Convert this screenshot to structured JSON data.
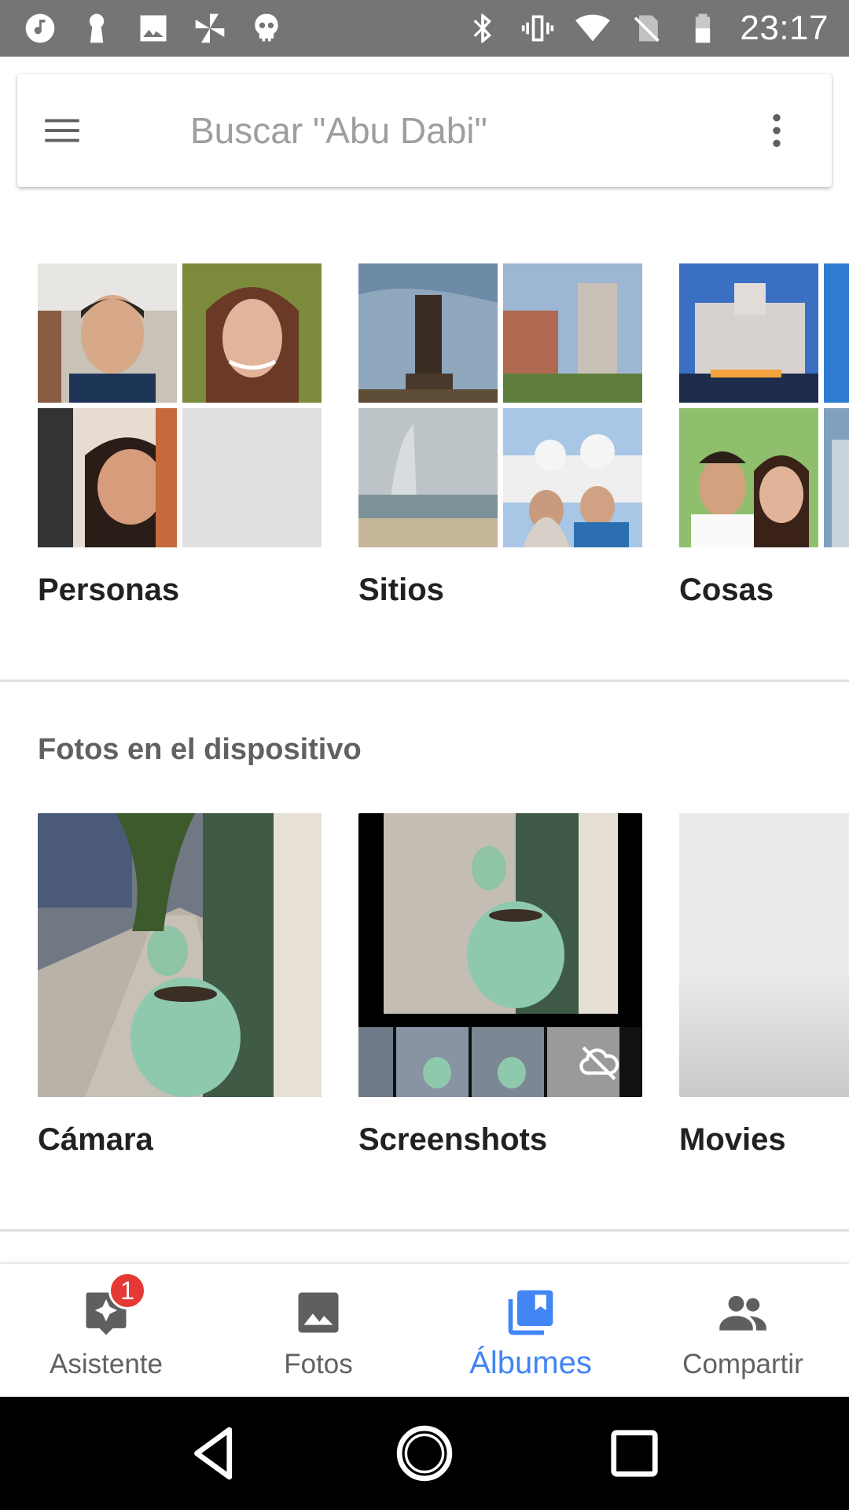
{
  "status_bar": {
    "time": "23:17",
    "left_icons": [
      "music-note-icon",
      "keyhole-icon",
      "image-icon",
      "pinwheel-icon",
      "skull-icon"
    ],
    "right_icons": [
      "bluetooth-icon",
      "vibrate-icon",
      "wifi-icon",
      "no-sim-icon",
      "battery-icon"
    ]
  },
  "search": {
    "placeholder": "Buscar \"Abu Dabi\""
  },
  "top_albums": [
    {
      "label": "Personas"
    },
    {
      "label": "Sitios"
    },
    {
      "label": "Cosas"
    }
  ],
  "device_section": {
    "title": "Fotos en el dispositivo",
    "albums": [
      {
        "label": "Cámara"
      },
      {
        "label": "Screenshots"
      },
      {
        "label": "Movies"
      }
    ]
  },
  "bottom_nav": {
    "items": [
      {
        "label": "Asistente",
        "badge": "1"
      },
      {
        "label": "Fotos"
      },
      {
        "label": "Álbumes",
        "active": true
      },
      {
        "label": "Compartir"
      }
    ]
  },
  "colors": {
    "status_bar": "#757575",
    "accent": "#4285f4",
    "badge": "#e53935"
  }
}
